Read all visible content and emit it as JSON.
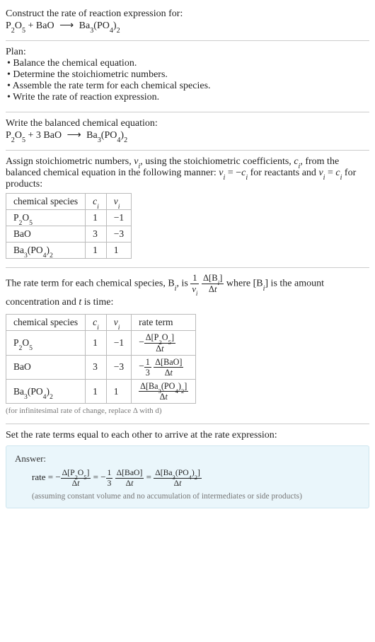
{
  "header": {
    "prompt": "Construct the rate of reaction expression for:"
  },
  "reaction_unbalanced": {
    "r1": "P",
    "r1s1": "2",
    "r1b": "O",
    "r1s2": "5",
    "plus": " + ",
    "r2": "BaO",
    "arrow": "⟶",
    "p1": "Ba",
    "p1s1": "3",
    "p1b": "(PO",
    "p1s2": "4",
    "p1c": ")",
    "p1s3": "2"
  },
  "plan": {
    "title": "Plan:",
    "items": [
      "Balance the chemical equation.",
      "Determine the stoichiometric numbers.",
      "Assemble the rate term for each chemical species.",
      "Write the rate of reaction expression."
    ]
  },
  "balanced": {
    "title": "Write the balanced chemical equation:",
    "coef_bao": "3"
  },
  "stoich_intro": {
    "part1": "Assign stoichiometric numbers, ",
    "nu": "ν",
    "sub_i": "i",
    "part2": ", using the stoichiometric coefficients, ",
    "c": "c",
    "part3": ", from the balanced chemical equation in the following manner: ",
    "eq1a": "ν",
    "eq1b": " = −",
    "eq1c": "c",
    "part4": " for reactants and ",
    "eq2a": "ν",
    "eq2b": " = ",
    "eq2c": "c",
    "part5": " for products:"
  },
  "stoich_table": {
    "h1": "chemical species",
    "h2": "c",
    "h2sub": "i",
    "h3": "ν",
    "h3sub": "i",
    "rows": [
      {
        "sp_a": "P",
        "sp_s1": "2",
        "sp_b": "O",
        "sp_s2": "5",
        "c": "1",
        "nu": "−1"
      },
      {
        "sp_a": "BaO",
        "sp_s1": "",
        "sp_b": "",
        "sp_s2": "",
        "c": "3",
        "nu": "−3"
      },
      {
        "sp_a": "Ba",
        "sp_s1": "3",
        "sp_b": "(PO",
        "sp_s2": "4",
        "sp_c": ")",
        "sp_s3": "2",
        "c": "1",
        "nu": "1"
      }
    ]
  },
  "rateterm_intro": {
    "part1": "The rate term for each chemical species, B",
    "sub_i": "i",
    "part2": ", is ",
    "onenu_num": "1",
    "onenu_den_a": "ν",
    "onenu_den_sub": "i",
    "dconc_num_a": "Δ[B",
    "dconc_num_sub": "i",
    "dconc_num_b": "]",
    "dconc_den_a": "Δ",
    "dconc_den_b": "t",
    "part3": " where [B",
    "part4": "] is the amount concentration and ",
    "t": "t",
    "part5": " is time:"
  },
  "rate_table": {
    "h1": "chemical species",
    "h2": "c",
    "h2sub": "i",
    "h3": "ν",
    "h3sub": "i",
    "h4": "rate term",
    "rows": [
      {
        "sp_a": "P",
        "sp_s1": "2",
        "sp_b": "O",
        "sp_s2": "5",
        "c": "1",
        "nu": "−1",
        "neg": "−",
        "num_a": "Δ[P",
        "num_s1": "2",
        "num_b": "O",
        "num_s2": "5",
        "num_c": "]",
        "den_a": "Δ",
        "den_t": "t"
      },
      {
        "sp_a": "BaO",
        "sp_s1": "",
        "sp_b": "",
        "sp_s2": "",
        "c": "3",
        "nu": "−3",
        "neg": "−",
        "coef_num": "1",
        "coef_den": "3",
        "num_a": "Δ[BaO]",
        "den_a": "Δ",
        "den_t": "t"
      },
      {
        "sp_a": "Ba",
        "sp_s1": "3",
        "sp_b": "(PO",
        "sp_s2": "4",
        "sp_c": ")",
        "sp_s3": "2",
        "c": "1",
        "nu": "1",
        "num_a": "Δ[Ba",
        "num_s1": "3",
        "num_b": "(PO",
        "num_s2": "4",
        "num_c": ")",
        "num_s3": "2",
        "num_d": "]",
        "den_a": "Δ",
        "den_t": "t"
      }
    ],
    "footnote": "(for infinitesimal rate of change, replace Δ with d)"
  },
  "final": {
    "intro": "Set the rate terms equal to each other to arrive at the rate expression:",
    "answer_label": "Answer:",
    "rate_word": "rate = ",
    "eq": " = ",
    "neg": "−",
    "p2o5_num_a": "Δ[P",
    "p2o5_s1": "2",
    "p2o5_num_b": "O",
    "p2o5_s2": "5",
    "p2o5_num_c": "]",
    "bao_coef_num": "1",
    "bao_coef_den": "3",
    "bao_num": "Δ[BaO]",
    "ba3_num_a": "Δ[Ba",
    "ba3_s1": "3",
    "ba3_num_b": "(PO",
    "ba3_s2": "4",
    "ba3_num_c": ")",
    "ba3_s3": "2",
    "ba3_num_d": "]",
    "dt_a": "Δ",
    "dt_t": "t",
    "assume": "(assuming constant volume and no accumulation of intermediates or side products)"
  }
}
